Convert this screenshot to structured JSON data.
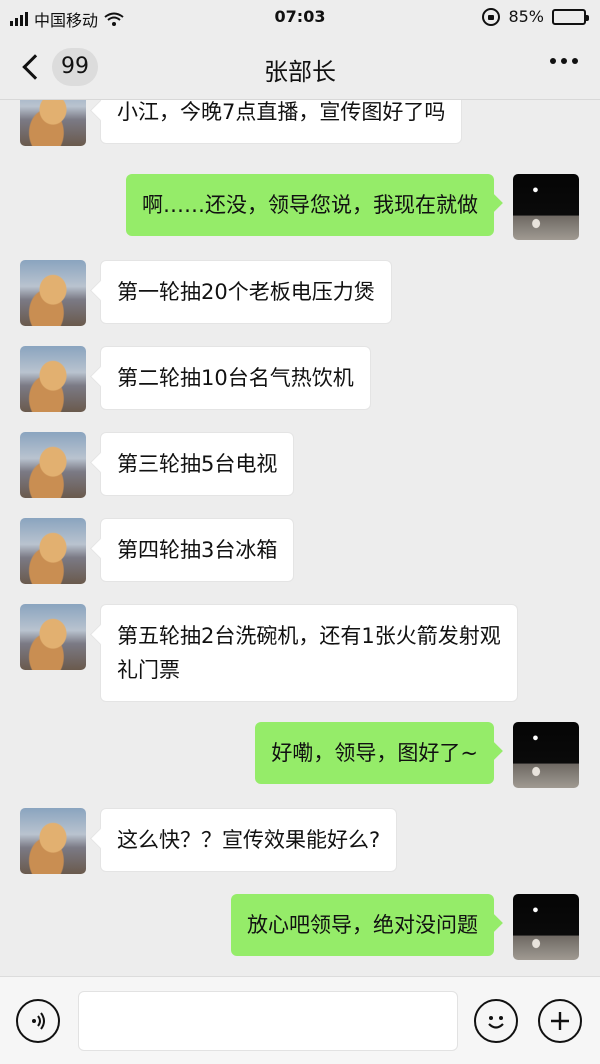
{
  "status_bar": {
    "carrier": "中国移动",
    "time": "07:03",
    "battery": "85%",
    "battery_level": 0.85
  },
  "nav": {
    "back_count": "99",
    "title": "张部长",
    "more_icon": "more-dots-icon"
  },
  "messages": [
    {
      "side": "left",
      "text": "小江，今晚7点直播，宣传图好了吗"
    },
    {
      "side": "right",
      "text": "啊……还没，领导您说，我现在就做"
    },
    {
      "side": "left",
      "text": "第一轮抽20个老板电压力煲"
    },
    {
      "side": "left",
      "text": "第二轮抽10台名气热饮机"
    },
    {
      "side": "left",
      "text": "第三轮抽5台电视"
    },
    {
      "side": "left",
      "text": "第四轮抽3台冰箱"
    },
    {
      "side": "left",
      "text": "第五轮抽2台洗碗机，还有1张火箭发射观\n礼门票"
    },
    {
      "side": "right",
      "text": "好嘞，领导，图好了~"
    },
    {
      "side": "left",
      "text": "这么快？？宣传效果能好么?"
    },
    {
      "side": "right",
      "text": "放心吧领导，绝对没问题"
    }
  ],
  "input_bar": {
    "voice_icon": "voice-icon",
    "emoji_icon": "emoji-icon",
    "plus_icon": "plus-icon"
  },
  "colors": {
    "background": "#ededed",
    "sent_bubble": "#95ec69",
    "received_bubble": "#ffffff"
  }
}
